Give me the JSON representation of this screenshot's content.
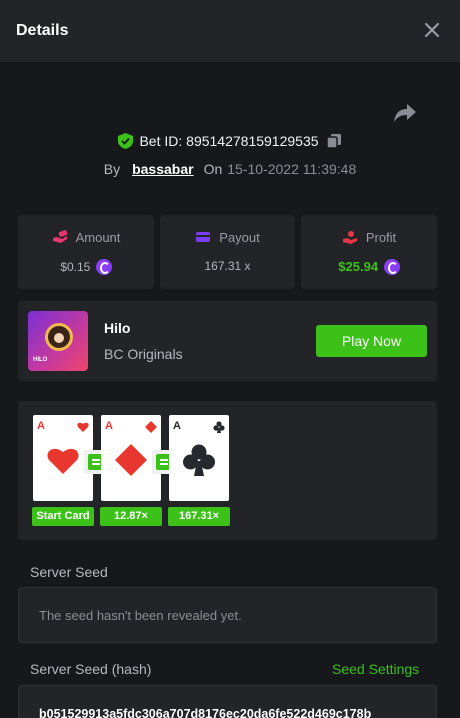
{
  "header": {
    "title": "Details"
  },
  "bet": {
    "id_text": "Bet ID: 89514278159129535",
    "by_label": "By",
    "username": "bassabar",
    "on_label": "On",
    "datetime": "15-10-2022 11:39:48"
  },
  "stats": [
    {
      "label": "Amount",
      "value": "$0.15",
      "icon": "money-hand-icon"
    },
    {
      "label": "Payout",
      "value": "167.31 x",
      "icon": "wallet-card-icon"
    },
    {
      "label": "Profit",
      "value": "$25.94",
      "icon": "profit-hand-icon"
    }
  ],
  "game": {
    "name": "Hilo",
    "provider": "BC Originals",
    "thumb_tag": "HILO",
    "play_label": "Play Now"
  },
  "rounds": [
    {
      "rank": "A",
      "suit": "heart",
      "label": "Start Card"
    },
    {
      "rank": "A",
      "suit": "diamond",
      "label": "12.87×"
    },
    {
      "rank": "A",
      "suit": "club",
      "label": "167.31×"
    }
  ],
  "seeds": {
    "server_seed_label": "Server Seed",
    "server_seed_value": "The seed hasn't been revealed yet.",
    "hash_label": "Server Seed (hash)",
    "settings_link": "Seed Settings",
    "hash_value": "b051529913a5fdc306a707d8176ec20da6fe522d469c178b"
  },
  "colors": {
    "accent_green": "#3bc117",
    "panel": "#232428",
    "background": "#17181b",
    "coin_purple": "#8a3df7"
  }
}
